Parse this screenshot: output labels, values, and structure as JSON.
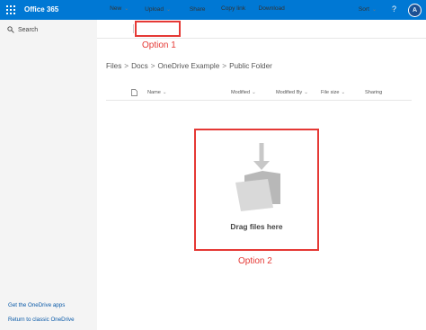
{
  "app": {
    "title": "Office 365",
    "help": "?",
    "avatar_initial": "A"
  },
  "leftnav": {
    "search_label": "Search",
    "links": [
      "Get the OneDrive apps",
      "Return to classic OneDrive"
    ]
  },
  "commands": {
    "new": "New",
    "upload": "Upload",
    "share": "Share",
    "copy_link": "Copy link",
    "download": "Download",
    "sort": "Sort"
  },
  "breadcrumb": [
    "Files",
    "Docs",
    "OneDrive Example",
    "Public Folder"
  ],
  "columns": [
    "Name",
    "Modified",
    "Modified By",
    "File size",
    "Sharing"
  ],
  "dropzone": {
    "text": "Drag files here"
  },
  "annotations": {
    "option1": "Option 1",
    "option2": "Option 2"
  },
  "colors": {
    "brand": "#0078d4",
    "annotation": "#e53935"
  },
  "icons": [
    "app-launcher-icon",
    "search-icon",
    "plus-icon",
    "upload-icon",
    "share-icon",
    "link-icon",
    "download-icon",
    "sort-icon",
    "view-options-icon",
    "info-icon",
    "file-type-icon",
    "folder-icon"
  ]
}
